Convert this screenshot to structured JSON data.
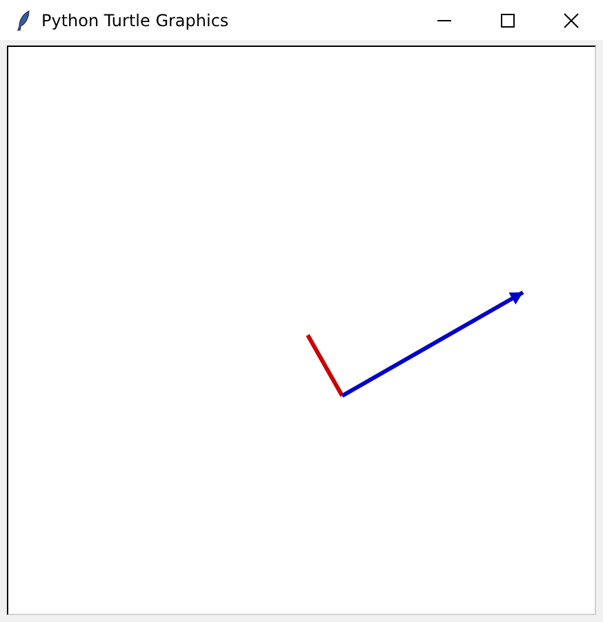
{
  "window": {
    "title": "Python Turtle Graphics"
  },
  "canvas": {
    "paths": [
      {
        "kind": "line",
        "color": "#cc0000"
      },
      {
        "kind": "arrow",
        "color": "#0000cc"
      }
    ]
  }
}
